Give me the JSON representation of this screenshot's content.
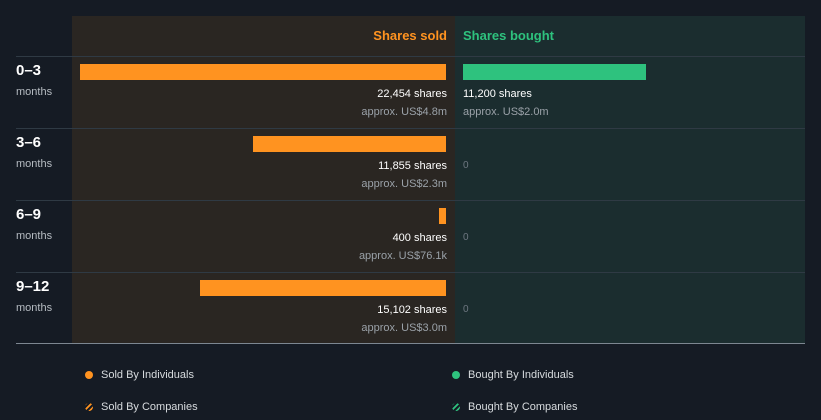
{
  "chart_data": {
    "type": "bar",
    "orientation": "horizontal-diverging",
    "columns": {
      "sold": "Shares sold",
      "bought": "Shares bought"
    },
    "categories": [
      {
        "period": "0–3",
        "unit": "months"
      },
      {
        "period": "3–6",
        "unit": "months"
      },
      {
        "period": "6–9",
        "unit": "months"
      },
      {
        "period": "9–12",
        "unit": "months"
      }
    ],
    "series": [
      {
        "name": "Shares sold",
        "values": [
          22454,
          11855,
          400,
          15102
        ],
        "shares_labels": [
          "22,454 shares",
          "11,855 shares",
          "400 shares",
          "15,102 shares"
        ],
        "approx_labels": [
          "approx. US$4.8m",
          "approx. US$2.3m",
          "approx. US$76.1k",
          "approx. US$3.0m"
        ]
      },
      {
        "name": "Shares bought",
        "values": [
          11200,
          0,
          0,
          0
        ],
        "shares_labels": [
          "11,200 shares",
          "",
          "",
          ""
        ],
        "approx_labels": [
          "approx. US$2.0m",
          "",
          "",
          ""
        ],
        "zero_label": "0"
      }
    ],
    "xlim": [
      0,
      22454
    ]
  },
  "legend": [
    {
      "label": "Sold By Individuals",
      "style": "dot",
      "color": "#ff9320"
    },
    {
      "label": "Bought By Individuals",
      "style": "dot",
      "color": "#2ec27e"
    },
    {
      "label": "Sold By Companies",
      "style": "hatched",
      "color": "#ff9320"
    },
    {
      "label": "Bought By Companies",
      "style": "hatched",
      "color": "#2ec27e"
    }
  ],
  "colors": {
    "sold": "#ff9320",
    "bought": "#2ec27e",
    "sold_header": "#ff9320",
    "bought_header": "#2ec27e"
  }
}
